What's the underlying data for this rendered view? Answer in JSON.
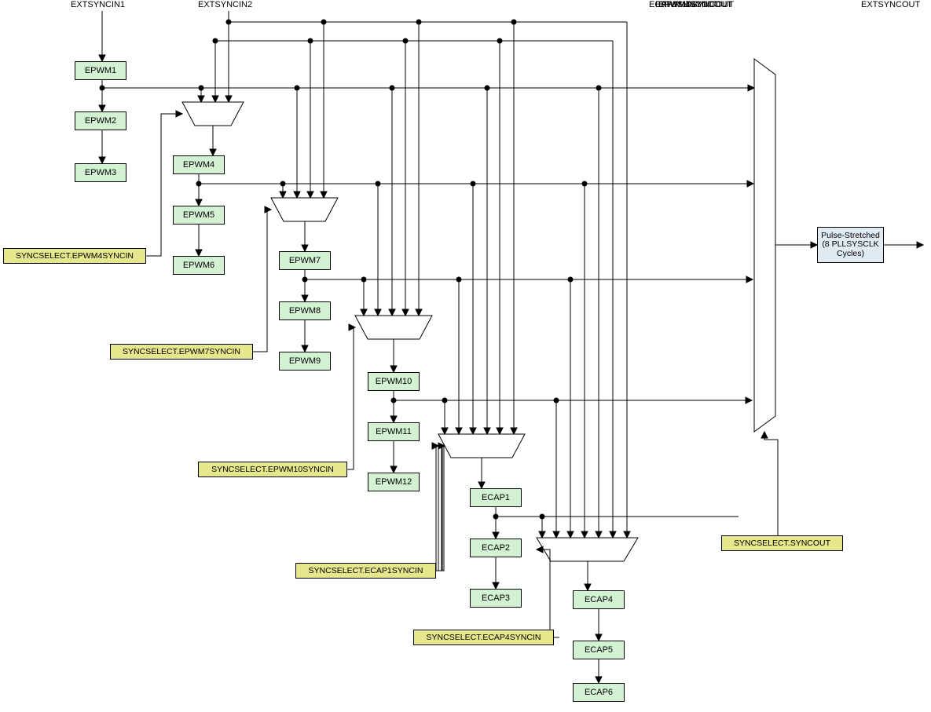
{
  "inputs": {
    "ext1": "EXTSYNCIN1",
    "ext2": "EXTSYNCIN2"
  },
  "outputs": {
    "o1": "EPWM1SYNCOUT",
    "o4": "EPWM4SYNCOUT",
    "o7": "EPWM7SYNCOUT",
    "o10": "EPWM10SYNCOUT",
    "oecap": "ECAP1SYNCOUT",
    "ext": "EXTSYNCOUT"
  },
  "blocks": {
    "epwm1": "EPWM1",
    "epwm2": "EPWM2",
    "epwm3": "EPWM3",
    "epwm4": "EPWM4",
    "epwm5": "EPWM5",
    "epwm6": "EPWM6",
    "epwm7": "EPWM7",
    "epwm8": "EPWM8",
    "epwm9": "EPWM9",
    "epwm10": "EPWM10",
    "epwm11": "EPWM11",
    "epwm12": "EPWM12",
    "ecap1": "ECAP1",
    "ecap2": "ECAP2",
    "ecap3": "ECAP3",
    "ecap4": "ECAP4",
    "ecap5": "ECAP5",
    "ecap6": "ECAP6",
    "pulse": "Pulse-Stretched (8 PLLSYSCLK Cycles)"
  },
  "selects": {
    "s4": "SYNCSELECT.EPWM4SYNCIN",
    "s7": "SYNCSELECT.EPWM7SYNCIN",
    "s10": "SYNCSELECT.EPWM10SYNCIN",
    "secap1": "SYNCSELECT.ECAP1SYNCIN",
    "secap4": "SYNCSELECT.ECAP4SYNCIN",
    "sout": "SYNCSELECT.SYNCOUT"
  }
}
